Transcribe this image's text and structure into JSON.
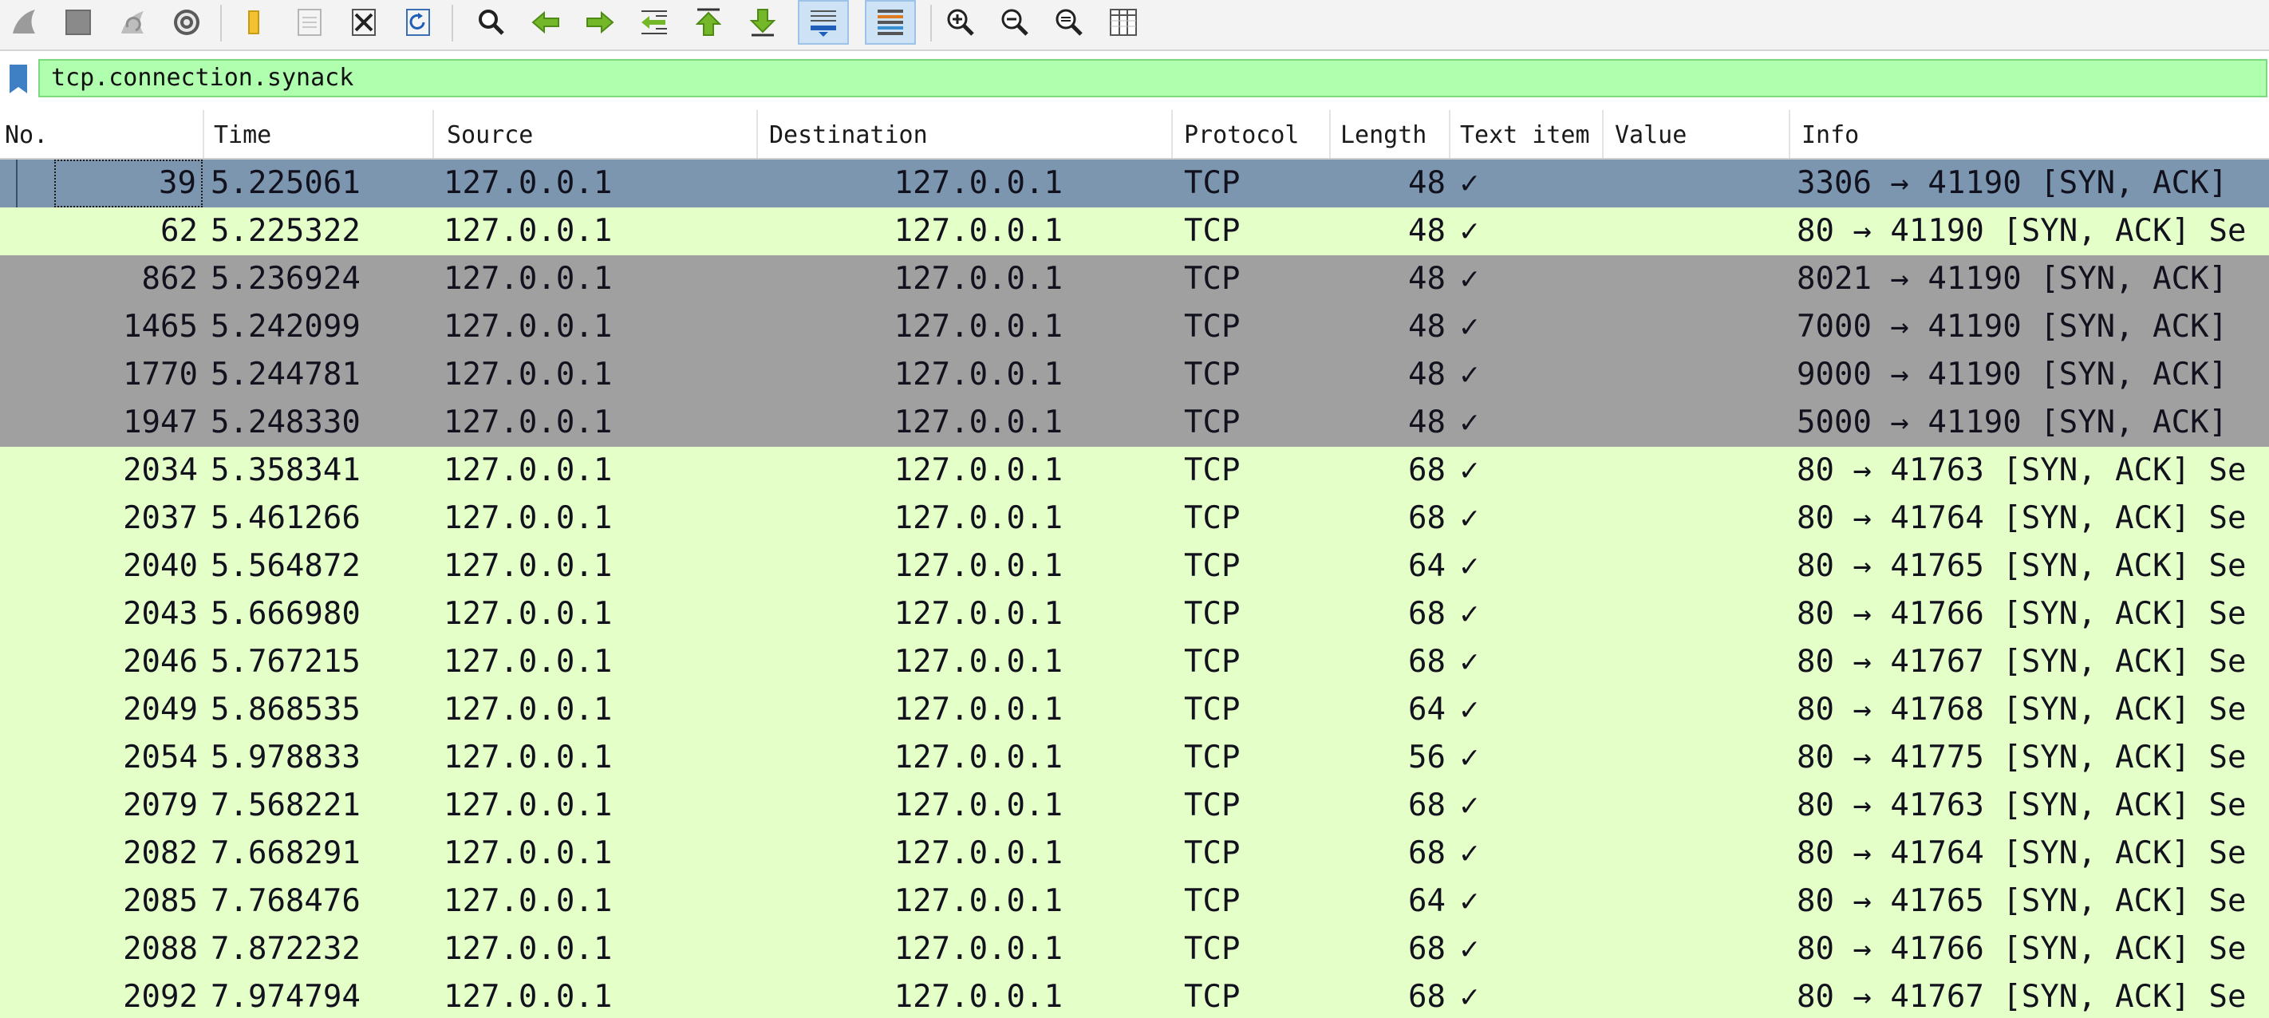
{
  "toolbar": {
    "buttons": [
      {
        "name": "shark-fin-start-icon",
        "label": "Start capture"
      },
      {
        "name": "stop-square-icon",
        "label": "Stop capture"
      },
      {
        "name": "restart-fin-icon",
        "label": "Restart capture"
      },
      {
        "name": "gear-icon",
        "label": "Capture options"
      },
      {
        "name": "folder-open-icon",
        "label": "Open file"
      },
      {
        "name": "save-file-icon",
        "label": "Save file"
      },
      {
        "name": "close-file-icon",
        "label": "Close file"
      },
      {
        "name": "reload-icon",
        "label": "Reload file"
      },
      {
        "name": "find-magnifier-icon",
        "label": "Find packet"
      },
      {
        "name": "arrow-left-icon",
        "label": "Go back"
      },
      {
        "name": "arrow-right-icon",
        "label": "Go forward"
      },
      {
        "name": "go-to-packet-icon",
        "label": "Go to packet"
      },
      {
        "name": "arrow-up-first-icon",
        "label": "First packet"
      },
      {
        "name": "arrow-down-last-icon",
        "label": "Last packet"
      },
      {
        "name": "autoscroll-icon",
        "label": "Auto scroll"
      },
      {
        "name": "colorize-icon",
        "label": "Colorize"
      },
      {
        "name": "zoom-in-icon",
        "label": "Zoom in"
      },
      {
        "name": "zoom-out-icon",
        "label": "Zoom out"
      },
      {
        "name": "zoom-normal-icon",
        "label": "Normal size"
      },
      {
        "name": "resize-columns-icon",
        "label": "Resize columns"
      }
    ]
  },
  "filter": {
    "value": "tcp.connection.synack",
    "icon": "bookmark-icon",
    "color": "#afffaf"
  },
  "columns": [
    "No.",
    "Time",
    "Source",
    "Destination",
    "Protocol",
    "Length",
    "Text item",
    "Value",
    "Info"
  ],
  "colors": {
    "row_default": "#e4ffc7",
    "row_gray": "#a0a0a0",
    "row_selected": "#7c96b0"
  },
  "packets": [
    {
      "no": "39",
      "time": "5.225061",
      "source": "127.0.0.1",
      "destination": "127.0.0.1",
      "protocol": "TCP",
      "length": "48",
      "text_item": "✓",
      "value": "",
      "info": "3306 → 41190 [SYN, ACK]",
      "style": "selected"
    },
    {
      "no": "62",
      "time": "5.225322",
      "source": "127.0.0.1",
      "destination": "127.0.0.1",
      "protocol": "TCP",
      "length": "48",
      "text_item": "✓",
      "value": "",
      "info": "80 → 41190 [SYN, ACK] Se",
      "style": "default"
    },
    {
      "no": "862",
      "time": "5.236924",
      "source": "127.0.0.1",
      "destination": "127.0.0.1",
      "protocol": "TCP",
      "length": "48",
      "text_item": "✓",
      "value": "",
      "info": "8021 → 41190 [SYN, ACK]",
      "style": "gray"
    },
    {
      "no": "1465",
      "time": "5.242099",
      "source": "127.0.0.1",
      "destination": "127.0.0.1",
      "protocol": "TCP",
      "length": "48",
      "text_item": "✓",
      "value": "",
      "info": "7000 → 41190 [SYN, ACK]",
      "style": "gray"
    },
    {
      "no": "1770",
      "time": "5.244781",
      "source": "127.0.0.1",
      "destination": "127.0.0.1",
      "protocol": "TCP",
      "length": "48",
      "text_item": "✓",
      "value": "",
      "info": "9000 → 41190 [SYN, ACK]",
      "style": "gray"
    },
    {
      "no": "1947",
      "time": "5.248330",
      "source": "127.0.0.1",
      "destination": "127.0.0.1",
      "protocol": "TCP",
      "length": "48",
      "text_item": "✓",
      "value": "",
      "info": "5000 → 41190 [SYN, ACK]",
      "style": "gray"
    },
    {
      "no": "2034",
      "time": "5.358341",
      "source": "127.0.0.1",
      "destination": "127.0.0.1",
      "protocol": "TCP",
      "length": "68",
      "text_item": "✓",
      "value": "",
      "info": "80 → 41763 [SYN, ACK] Se",
      "style": "default"
    },
    {
      "no": "2037",
      "time": "5.461266",
      "source": "127.0.0.1",
      "destination": "127.0.0.1",
      "protocol": "TCP",
      "length": "68",
      "text_item": "✓",
      "value": "",
      "info": "80 → 41764 [SYN, ACK] Se",
      "style": "default"
    },
    {
      "no": "2040",
      "time": "5.564872",
      "source": "127.0.0.1",
      "destination": "127.0.0.1",
      "protocol": "TCP",
      "length": "64",
      "text_item": "✓",
      "value": "",
      "info": "80 → 41765 [SYN, ACK] Se",
      "style": "default"
    },
    {
      "no": "2043",
      "time": "5.666980",
      "source": "127.0.0.1",
      "destination": "127.0.0.1",
      "protocol": "TCP",
      "length": "68",
      "text_item": "✓",
      "value": "",
      "info": "80 → 41766 [SYN, ACK] Se",
      "style": "default"
    },
    {
      "no": "2046",
      "time": "5.767215",
      "source": "127.0.0.1",
      "destination": "127.0.0.1",
      "protocol": "TCP",
      "length": "68",
      "text_item": "✓",
      "value": "",
      "info": "80 → 41767 [SYN, ACK] Se",
      "style": "default"
    },
    {
      "no": "2049",
      "time": "5.868535",
      "source": "127.0.0.1",
      "destination": "127.0.0.1",
      "protocol": "TCP",
      "length": "64",
      "text_item": "✓",
      "value": "",
      "info": "80 → 41768 [SYN, ACK] Se",
      "style": "default"
    },
    {
      "no": "2054",
      "time": "5.978833",
      "source": "127.0.0.1",
      "destination": "127.0.0.1",
      "protocol": "TCP",
      "length": "56",
      "text_item": "✓",
      "value": "",
      "info": "80 → 41775 [SYN, ACK] Se",
      "style": "default"
    },
    {
      "no": "2079",
      "time": "7.568221",
      "source": "127.0.0.1",
      "destination": "127.0.0.1",
      "protocol": "TCP",
      "length": "68",
      "text_item": "✓",
      "value": "",
      "info": "80 → 41763 [SYN, ACK] Se",
      "style": "default"
    },
    {
      "no": "2082",
      "time": "7.668291",
      "source": "127.0.0.1",
      "destination": "127.0.0.1",
      "protocol": "TCP",
      "length": "68",
      "text_item": "✓",
      "value": "",
      "info": "80 → 41764 [SYN, ACK] Se",
      "style": "default"
    },
    {
      "no": "2085",
      "time": "7.768476",
      "source": "127.0.0.1",
      "destination": "127.0.0.1",
      "protocol": "TCP",
      "length": "64",
      "text_item": "✓",
      "value": "",
      "info": "80 → 41765 [SYN, ACK] Se",
      "style": "default"
    },
    {
      "no": "2088",
      "time": "7.872232",
      "source": "127.0.0.1",
      "destination": "127.0.0.1",
      "protocol": "TCP",
      "length": "68",
      "text_item": "✓",
      "value": "",
      "info": "80 → 41766 [SYN, ACK] Se",
      "style": "default"
    },
    {
      "no": "2092",
      "time": "7.974794",
      "source": "127.0.0.1",
      "destination": "127.0.0.1",
      "protocol": "TCP",
      "length": "68",
      "text_item": "✓",
      "value": "",
      "info": "80 → 41767 [SYN, ACK] Se",
      "style": "default"
    }
  ]
}
